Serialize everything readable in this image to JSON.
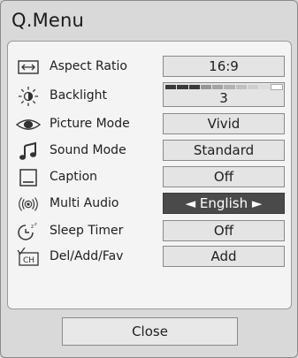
{
  "title": "Q.Menu",
  "items": [
    {
      "label": "Aspect Ratio",
      "value": "16:9",
      "icon": "aspect-ratio-icon"
    },
    {
      "label": "Backlight",
      "value": "3",
      "icon": "backlight-icon",
      "level": 0.3
    },
    {
      "label": "Picture Mode",
      "value": "Vivid",
      "icon": "eye-icon"
    },
    {
      "label": "Sound Mode",
      "value": "Standard",
      "icon": "music-note-icon"
    },
    {
      "label": "Caption",
      "value": "Off",
      "icon": "caption-icon"
    },
    {
      "label": "Multi Audio",
      "value": "◄ English ►",
      "icon": "audio-icon",
      "selected": true
    },
    {
      "label": "Sleep Timer",
      "value": "Off",
      "icon": "sleep-timer-icon"
    },
    {
      "label": "Del/Add/Fav",
      "value": "Add",
      "icon": "channel-icon"
    }
  ],
  "close_label": "Close",
  "colors": {
    "background": "#d9d9d9",
    "panel": "#f4f4f4",
    "value_box": "#e4e4e4",
    "selected_box": "#4a4a4a",
    "selected_text": "#ffffff"
  }
}
